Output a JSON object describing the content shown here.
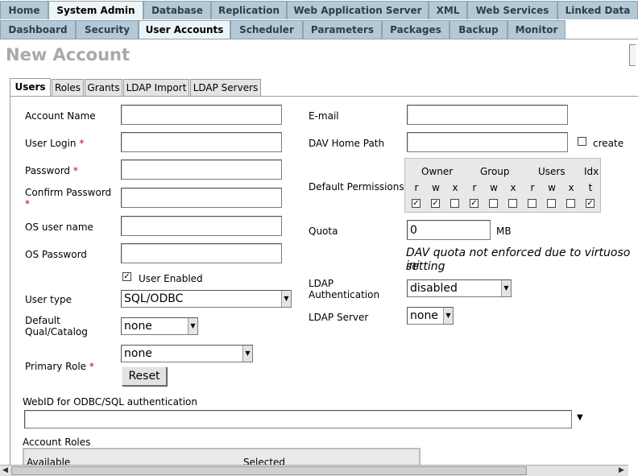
{
  "nav_row1": [
    {
      "label": "Home"
    },
    {
      "label": "System Admin",
      "active": true
    },
    {
      "label": "Database"
    },
    {
      "label": "Replication"
    },
    {
      "label": "Web Application Server"
    },
    {
      "label": "XML"
    },
    {
      "label": "Web Services"
    },
    {
      "label": "Linked Data"
    }
  ],
  "nav_row2": [
    {
      "label": "Dashboard"
    },
    {
      "label": "Security"
    },
    {
      "label": "User Accounts",
      "active": true
    },
    {
      "label": "Scheduler"
    },
    {
      "label": "Parameters"
    },
    {
      "label": "Packages"
    },
    {
      "label": "Backup"
    },
    {
      "label": "Monitor"
    }
  ],
  "page_title": "New Account",
  "sub_tabs": [
    {
      "label": "Users",
      "active": true
    },
    {
      "label": "Roles"
    },
    {
      "label": "Grants"
    },
    {
      "label": "LDAP Import"
    },
    {
      "label": "LDAP Servers"
    }
  ],
  "form": {
    "account_name": {
      "label": "Account Name",
      "value": ""
    },
    "user_login": {
      "label": "User Login",
      "required": "*",
      "value": ""
    },
    "password": {
      "label": "Password",
      "required": "*",
      "value": ""
    },
    "confirm_password": {
      "label": "Confirm Password",
      "required": "*",
      "value": ""
    },
    "os_user_name": {
      "label": "OS user name",
      "value": ""
    },
    "os_password": {
      "label": "OS Password",
      "value": ""
    },
    "user_enabled": {
      "label": "User Enabled",
      "checked": true,
      "mark": "✓"
    },
    "user_type": {
      "label": "User type",
      "value": "SQL/ODBC"
    },
    "default_qual": {
      "label_line1": "Default",
      "label_line2": "Qual/Catalog",
      "value": "none"
    },
    "primary_role": {
      "label": "Primary Role",
      "required": "*",
      "value": "none"
    },
    "reset_button": "Reset",
    "email": {
      "label": "E-mail",
      "value": ""
    },
    "dav_home_path": {
      "label": "DAV Home Path",
      "value": "",
      "create_label": "create",
      "create_checked": false
    },
    "default_permissions": {
      "label": "Default Permissions",
      "groups": [
        "Owner",
        "Group",
        "Users",
        "Idx"
      ],
      "letters": [
        "r",
        "w",
        "x",
        "r",
        "w",
        "x",
        "r",
        "w",
        "x",
        "t"
      ],
      "checked": [
        true,
        true,
        false,
        true,
        false,
        false,
        false,
        false,
        false,
        true
      ],
      "mark": "✓"
    },
    "quota": {
      "label": "Quota",
      "value": "0",
      "unit": "MB"
    },
    "dav_quota_note_line1": "DAV quota not enforced due to virtuoso ini",
    "dav_quota_note_line2": "setting",
    "ldap_authentication": {
      "label_line1": "LDAP",
      "label_line2": "Authentication",
      "value": "disabled"
    },
    "ldap_server": {
      "label": "LDAP Server",
      "value": "none"
    },
    "webid": {
      "label": "WebID for ODBC/SQL authentication",
      "value": "",
      "arrow": "▼"
    },
    "account_roles": {
      "label": "Account Roles",
      "col_available": "Available",
      "col_selected": "Selected"
    }
  },
  "icons": {
    "select_arrow": "▼",
    "scroll_left": "◀",
    "scroll_right": "▶"
  },
  "colors": {
    "nav_tab_bg": "#b4c8d5",
    "nav_active_bg": "#eef3f6",
    "required": "#cc0000",
    "title": "#a9a9a9"
  }
}
